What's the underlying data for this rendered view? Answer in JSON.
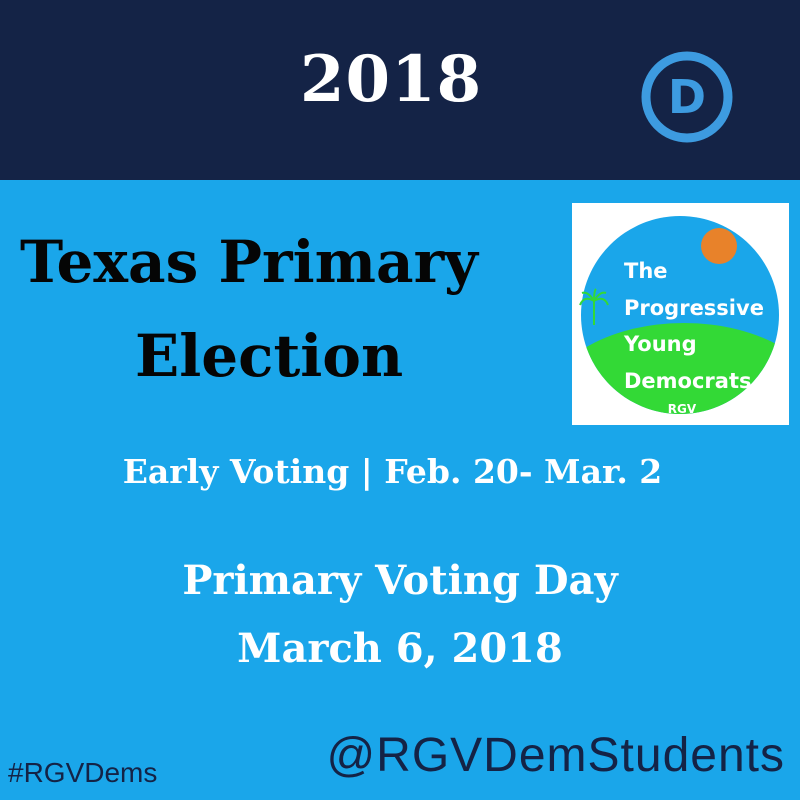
{
  "header": {
    "year": "2018",
    "party_logo_letter": "D",
    "party_logo_icon": "democratic-party-d-icon"
  },
  "title": {
    "line1": "Texas Primary",
    "line2": "Election"
  },
  "badge": {
    "line1": "The",
    "line2": "Progressive",
    "line3": "Young",
    "line4": "Democrats",
    "line5": "RGV",
    "icon": "palm-tree-icon"
  },
  "early_voting": "Early Voting | Feb. 20- Mar. 2",
  "primary_day": {
    "label": "Primary Voting Day",
    "date": "March 6, 2018"
  },
  "footer": {
    "hashtag": "#RGVDems",
    "handle": "@RGVDemStudents"
  },
  "colors": {
    "background": "#1aa6ea",
    "header_bar": "#142346",
    "badge_sky": "#1aa6ea",
    "badge_hill": "#33d936",
    "badge_sun": "#e8822a",
    "badge_text": "#ffffff",
    "title_text": "#050505"
  }
}
